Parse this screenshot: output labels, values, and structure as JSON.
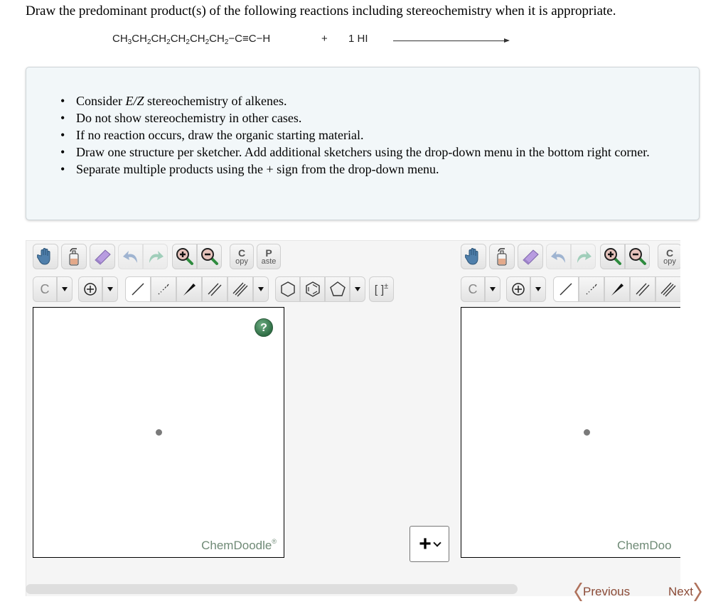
{
  "question": "Draw the predominant product(s) of the following reactions including stereochemistry when it is appropriate.",
  "reaction": {
    "reactant_parts": [
      {
        "text": "CH",
        "sub": "3"
      },
      {
        "text": "CH",
        "sub": "2"
      },
      {
        "text": "CH",
        "sub": "2"
      },
      {
        "text": "CH",
        "sub": "2"
      },
      {
        "text": "CH",
        "sub": "2"
      },
      {
        "text": "CH",
        "sub": "2"
      },
      {
        "text": "−C≡C−H",
        "sub": ""
      }
    ],
    "plus": "+",
    "reagent": "1 HI"
  },
  "instructions": [
    {
      "pre": "Consider ",
      "em": "E/Z",
      "post": " stereochemistry of alkenes."
    },
    {
      "pre": "Do not show stereochemistry in other cases.",
      "em": "",
      "post": ""
    },
    {
      "pre": "If no reaction occurs, draw the organic starting material.",
      "em": "",
      "post": ""
    },
    {
      "pre": "Draw one structure per sketcher. Add additional sketchers using the drop-down menu in the bottom right corner.",
      "em": "",
      "post": ""
    },
    {
      "pre": "Separate multiple products using the + sign from the drop-down menu.",
      "em": "",
      "post": ""
    }
  ],
  "sketcher": {
    "toolbar_row1": {
      "copy": {
        "big": "C",
        "small": "opy"
      },
      "paste": {
        "big": "P",
        "small": "aste"
      }
    },
    "toolbar_row2": {
      "element": "C",
      "charge_label": "[ ]",
      "charge_sup": "±"
    },
    "help": "?",
    "brand": "ChemDoodle",
    "brand_mark": "®",
    "brand_truncated": "ChemDoo"
  },
  "add_menu": {
    "symbol": "+"
  },
  "navigation": {
    "previous": "Previous",
    "next": "Next"
  },
  "colors": {
    "nav_accent": "#8b4a36",
    "brand_text": "#6f8a76",
    "help_button": "#2f6e45",
    "instructions_bg": "#f2f7f9"
  }
}
